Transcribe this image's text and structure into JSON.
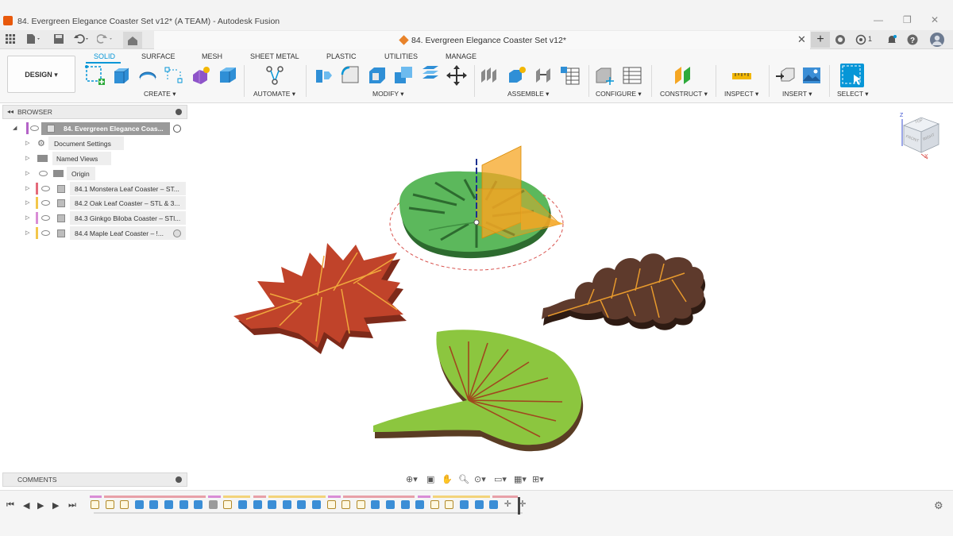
{
  "window": {
    "title": "84. Evergreen Elegance Coaster Set v12* (A TEAM) - Autodesk Fusion",
    "minimize": "—",
    "restore": "❐",
    "close": "✕"
  },
  "document_tab": {
    "title": "84. Evergreen Elegance Coaster Set v12*",
    "close": "✕",
    "new_tab": "+"
  },
  "qat": {
    "badge_count": "1"
  },
  "workspace": {
    "label": "DESIGN ▾"
  },
  "tabs": [
    "SOLID",
    "SURFACE",
    "MESH",
    "SHEET METAL",
    "PLASTIC",
    "UTILITIES",
    "MANAGE"
  ],
  "groups": [
    "CREATE ▾",
    "AUTOMATE ▾",
    "MODIFY ▾",
    "ASSEMBLE ▾",
    "CONFIGURE ▾",
    "CONSTRUCT ▾",
    "INSPECT ▾",
    "INSERT ▾",
    "SELECT ▾"
  ],
  "browser": {
    "header": "BROWSER",
    "root": "84. Evergreen Elegance Coas...",
    "items": [
      {
        "label": "Document Settings"
      },
      {
        "label": "Named Views"
      },
      {
        "label": "Origin"
      },
      {
        "label": "84.1 Monstera Leaf Coaster – ST..."
      },
      {
        "label": "84.2 Oak Leaf Coaster – STL & 3..."
      },
      {
        "label": "84.3 Ginkgo Biloba Coaster – STl..."
      },
      {
        "label": "84.4 Maple Leaf Coaster – !..."
      }
    ]
  },
  "comments": {
    "header": "COMMENTS"
  },
  "viewcube": {
    "top": "TOP",
    "front": "FRONT",
    "right": "RIGHT",
    "z": "Z",
    "x": "X"
  },
  "colors": {
    "accent": "#0696d7",
    "maple": "#c0432a",
    "oak": "#5e3a2c",
    "ginkgo": "#8cc63f",
    "monstera": "#5cb85c",
    "plane": "#f5a623"
  }
}
